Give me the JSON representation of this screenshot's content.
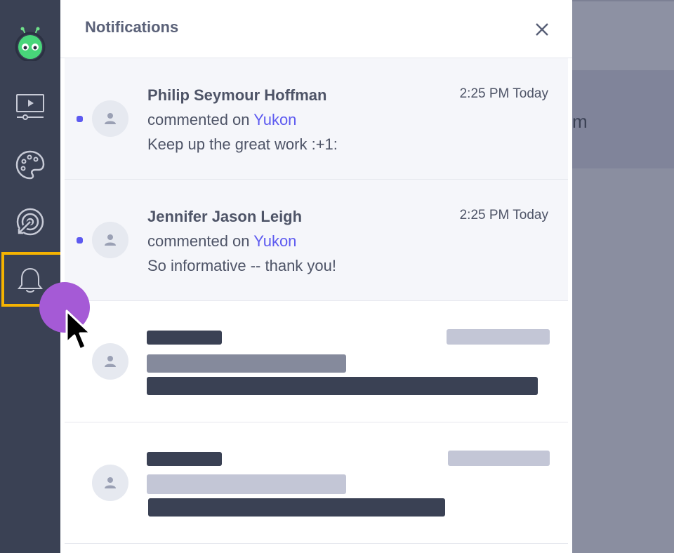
{
  "panel": {
    "title": "Notifications",
    "close_icon": "close-icon"
  },
  "sidebar": {
    "items": [
      {
        "icon": "robot-logo-icon"
      },
      {
        "icon": "video-icon"
      },
      {
        "icon": "palette-icon"
      },
      {
        "icon": "target-icon"
      },
      {
        "icon": "bell-icon",
        "highlighted": true
      }
    ]
  },
  "notifications": [
    {
      "name": "Philip Seymour Hoffman",
      "time": "2:25 PM Today",
      "action": "commented on ",
      "target": "Yukon",
      "message": "Keep up the great work :+1:",
      "unread": true
    },
    {
      "name": "Jennifer Jason Leigh",
      "time": "2:25 PM Today",
      "action": "commented on ",
      "target": "Yukon",
      "message": "So informative -- thank you!",
      "unread": true
    }
  ],
  "background": {
    "partial_text": "m"
  },
  "colors": {
    "sidebar": "#3a4154",
    "accent": "#5d5af0",
    "highlight": "#f5b301",
    "click_indicator": "#a55ad6"
  }
}
